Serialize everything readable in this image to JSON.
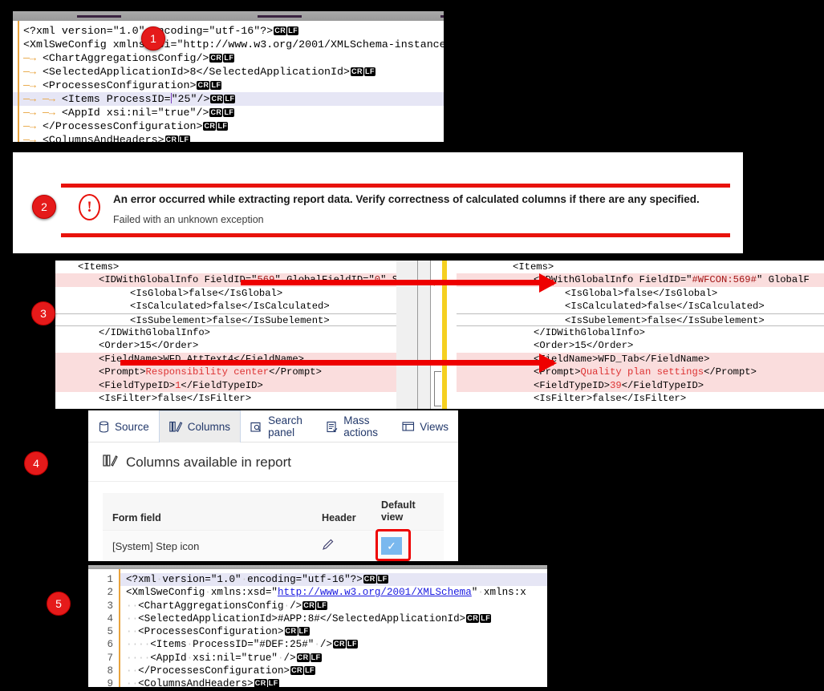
{
  "steps": [
    {
      "n": "1"
    },
    {
      "n": "2"
    },
    {
      "n": "3"
    },
    {
      "n": "4"
    },
    {
      "n": "5"
    }
  ],
  "panel1": {
    "lines": [
      {
        "text": "<?xml version=\"1.0\" encoding=\"utf-16\"?>",
        "crlf": true,
        "hl": false
      },
      {
        "text": "<XmlSweConfig xmlns:xsi=\"http://www.w3.org/2001/XMLSchema-instance",
        "crlf": false,
        "hl": false
      },
      {
        "text": "    <ChartAggregationsConfig/>",
        "crlf": true,
        "hl": false
      },
      {
        "text": "    <SelectedApplicationId>8</SelectedApplicationId>",
        "crlf": true,
        "hl": false
      },
      {
        "text": "    <ProcessesConfiguration>",
        "crlf": true,
        "hl": false
      },
      {
        "text": "        <Items ProcessID=\"25\"/>",
        "crlf": true,
        "hl": true
      },
      {
        "text": "        <AppId xsi:nil=\"true\"/>",
        "crlf": true,
        "hl": false
      },
      {
        "text": "    </ProcessesConfiguration>",
        "crlf": true,
        "hl": false
      },
      {
        "text": "    <ColumnsAndHeaders>",
        "crlf": true,
        "hl": false
      }
    ],
    "crlf_cr": "CR",
    "crlf_lf": "LF"
  },
  "panel2": {
    "icon": "exclamation-icon",
    "title": "An error occurred while extracting report data. Verify correctness of calculated columns if there are any specified.",
    "subtitle": "Failed with an unknown exception"
  },
  "panel3": {
    "left_lines": [
      {
        "text": "<Items>",
        "diff": false,
        "box": false,
        "indent": 0
      },
      {
        "text": "<IDWithGlobalInfo FieldID=\"569\" GlobalFieldID=\"0\" S",
        "diff": true,
        "box": false,
        "indent": 2
      },
      {
        "text": "<IsGlobal>false</IsGlobal>",
        "diff": false,
        "box": false,
        "indent": 5
      },
      {
        "text": "<IsCalculated>false</IsCalculated>",
        "diff": false,
        "box": false,
        "indent": 5
      },
      {
        "text": "<IsSubelement>false</IsSubelement>",
        "diff": false,
        "box": true,
        "indent": 5
      },
      {
        "text": "</IDWithGlobalInfo>",
        "diff": false,
        "box": false,
        "indent": 2
      },
      {
        "text": "<Order>15</Order>",
        "diff": false,
        "box": false,
        "indent": 2
      },
      {
        "text": "<FieldName>WFD_AttText4</FieldName>",
        "diff": true,
        "box": false,
        "indent": 2
      },
      {
        "text": "<Prompt>Responsibility center</Prompt>",
        "diff": true,
        "box": false,
        "indent": 2
      },
      {
        "text": "<FieldTypeID>1</FieldTypeID>",
        "diff": true,
        "box": false,
        "indent": 2
      },
      {
        "text": "<IsFilter>false</IsFilter>",
        "diff": false,
        "box": false,
        "indent": 2
      }
    ],
    "right_lines": [
      {
        "text": "<Items>",
        "diff": false,
        "box": false,
        "indent": 0
      },
      {
        "text": "<IDWithGlobalInfo FieldID=\"#WFCON:569#\" GlobalF",
        "diff": true,
        "box": false,
        "indent": 2
      },
      {
        "text": "<IsGlobal>false</IsGlobal>",
        "diff": false,
        "box": false,
        "indent": 5
      },
      {
        "text": "<IsCalculated>false</IsCalculated>",
        "diff": false,
        "box": false,
        "indent": 5
      },
      {
        "text": "<IsSubelement>false</IsSubelement>",
        "diff": false,
        "box": true,
        "indent": 5
      },
      {
        "text": "</IDWithGlobalInfo>",
        "diff": false,
        "box": false,
        "indent": 2
      },
      {
        "text": "<Order>15</Order>",
        "diff": false,
        "box": false,
        "indent": 2
      },
      {
        "text": "<FieldName>WFD_Tab</FieldName>",
        "diff": true,
        "box": false,
        "indent": 2
      },
      {
        "text": "<Prompt>Quality plan settings</Prompt>",
        "diff": true,
        "box": false,
        "indent": 2
      },
      {
        "text": "<FieldTypeID>39</FieldTypeID>",
        "diff": true,
        "box": false,
        "indent": 2
      },
      {
        "text": "<IsFilter>false</IsFilter>",
        "diff": false,
        "box": false,
        "indent": 2
      }
    ]
  },
  "panel4": {
    "tabs": [
      {
        "label": "Source",
        "icon": "database-icon",
        "active": false
      },
      {
        "label": "Columns",
        "icon": "columns-icon",
        "active": true
      },
      {
        "label": "Search panel",
        "icon": "search-panel-icon",
        "active": false
      },
      {
        "label": "Mass actions",
        "icon": "mass-actions-icon",
        "active": false
      },
      {
        "label": "Views",
        "icon": "views-icon",
        "active": false
      }
    ],
    "section_title": "Columns available in report",
    "section_icon": "columns-icon",
    "table": {
      "headers": [
        "Form field",
        "Header",
        "Default view"
      ],
      "rows": [
        {
          "form_field": "[System] Step icon",
          "header_icon": "pencil-icon",
          "default_view_checked": true
        }
      ]
    },
    "accent_checkbox": "#7ab8ee",
    "highlight_color": "#ee0000"
  },
  "panel5": {
    "line_numbers": [
      "1",
      "2",
      "3",
      "4",
      "5",
      "6",
      "7",
      "8",
      "9"
    ],
    "lines": [
      {
        "text": "<?xml version=\"1.0\" encoding=\"utf-16\"?>",
        "crlf": true,
        "hl": true
      },
      {
        "text": "<XmlSweConfig xmlns:xsd=\"http://www.w3.org/2001/XMLSchema\" xmlns:x",
        "crlf": false,
        "hl": false,
        "link": "http://www.w3.org/2001/XMLSchema"
      },
      {
        "text": "  <ChartAggregationsConfig />",
        "crlf": true,
        "hl": false
      },
      {
        "text": "  <SelectedApplicationId>#APP:8#</SelectedApplicationId>",
        "crlf": true,
        "hl": false
      },
      {
        "text": "  <ProcessesConfiguration>",
        "crlf": true,
        "hl": false
      },
      {
        "text": "    <Items ProcessID=\"#DEF:25#\" />",
        "crlf": true,
        "hl": false
      },
      {
        "text": "    <AppId xsi:nil=\"true\" />",
        "crlf": true,
        "hl": false
      },
      {
        "text": "  </ProcessesConfiguration>",
        "crlf": true,
        "hl": false
      },
      {
        "text": "  <ColumnsAndHeaders>",
        "crlf": true,
        "hl": false
      }
    ]
  }
}
